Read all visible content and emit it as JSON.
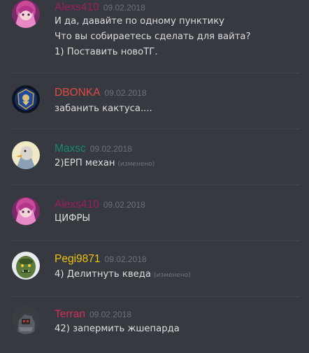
{
  "colors": {
    "background": "#36393f",
    "message_text": "#dcddde",
    "timestamp": "#6e7175",
    "edited": "#72767d",
    "divider": "#42454a"
  },
  "messages": [
    {
      "username": "Alexs410",
      "username_color": "#9b1f5c",
      "avatar_icon": "anime-avatar-icon",
      "timestamp": "09.02.2018",
      "lines": [
        {
          "text": "И да, давайте по одному пунктику"
        },
        {
          "text": "Что вы собираетесь сделать для вайта?"
        },
        {
          "text": "1) Поставить новоТГ."
        }
      ]
    },
    {
      "username": "DBONKA",
      "username_color": "#e04a44",
      "avatar_icon": "lion-emblem-avatar-icon",
      "timestamp": "09.02.2018",
      "lines": [
        {
          "text": "забанить кактуса...."
        }
      ]
    },
    {
      "username": "Maxsc",
      "username_color": "#1a8a6e",
      "avatar_icon": "bird-avatar-icon",
      "timestamp": "09.02.2018",
      "lines": [
        {
          "text": "2)ЕРП механ",
          "edited": "(изменено)"
        }
      ]
    },
    {
      "username": "Alexs410",
      "username_color": "#9b1f5c",
      "avatar_icon": "anime-avatar-icon",
      "timestamp": "09.02.2018",
      "lines": [
        {
          "text": "ЦИФРЫ"
        }
      ]
    },
    {
      "username": "Pegi9871",
      "username_color": "#f1c40f",
      "avatar_icon": "orc-avatar-icon",
      "timestamp": "09.02.2018",
      "lines": [
        {
          "text": "4) Делитнуть кведа",
          "edited": "(изменено)"
        }
      ]
    },
    {
      "username": "Terran",
      "username_color": "#d32f5c",
      "avatar_icon": "robot-avatar-icon",
      "timestamp": "09.02.2018",
      "lines": [
        {
          "text": "42) запермить жшепарда"
        }
      ]
    }
  ]
}
